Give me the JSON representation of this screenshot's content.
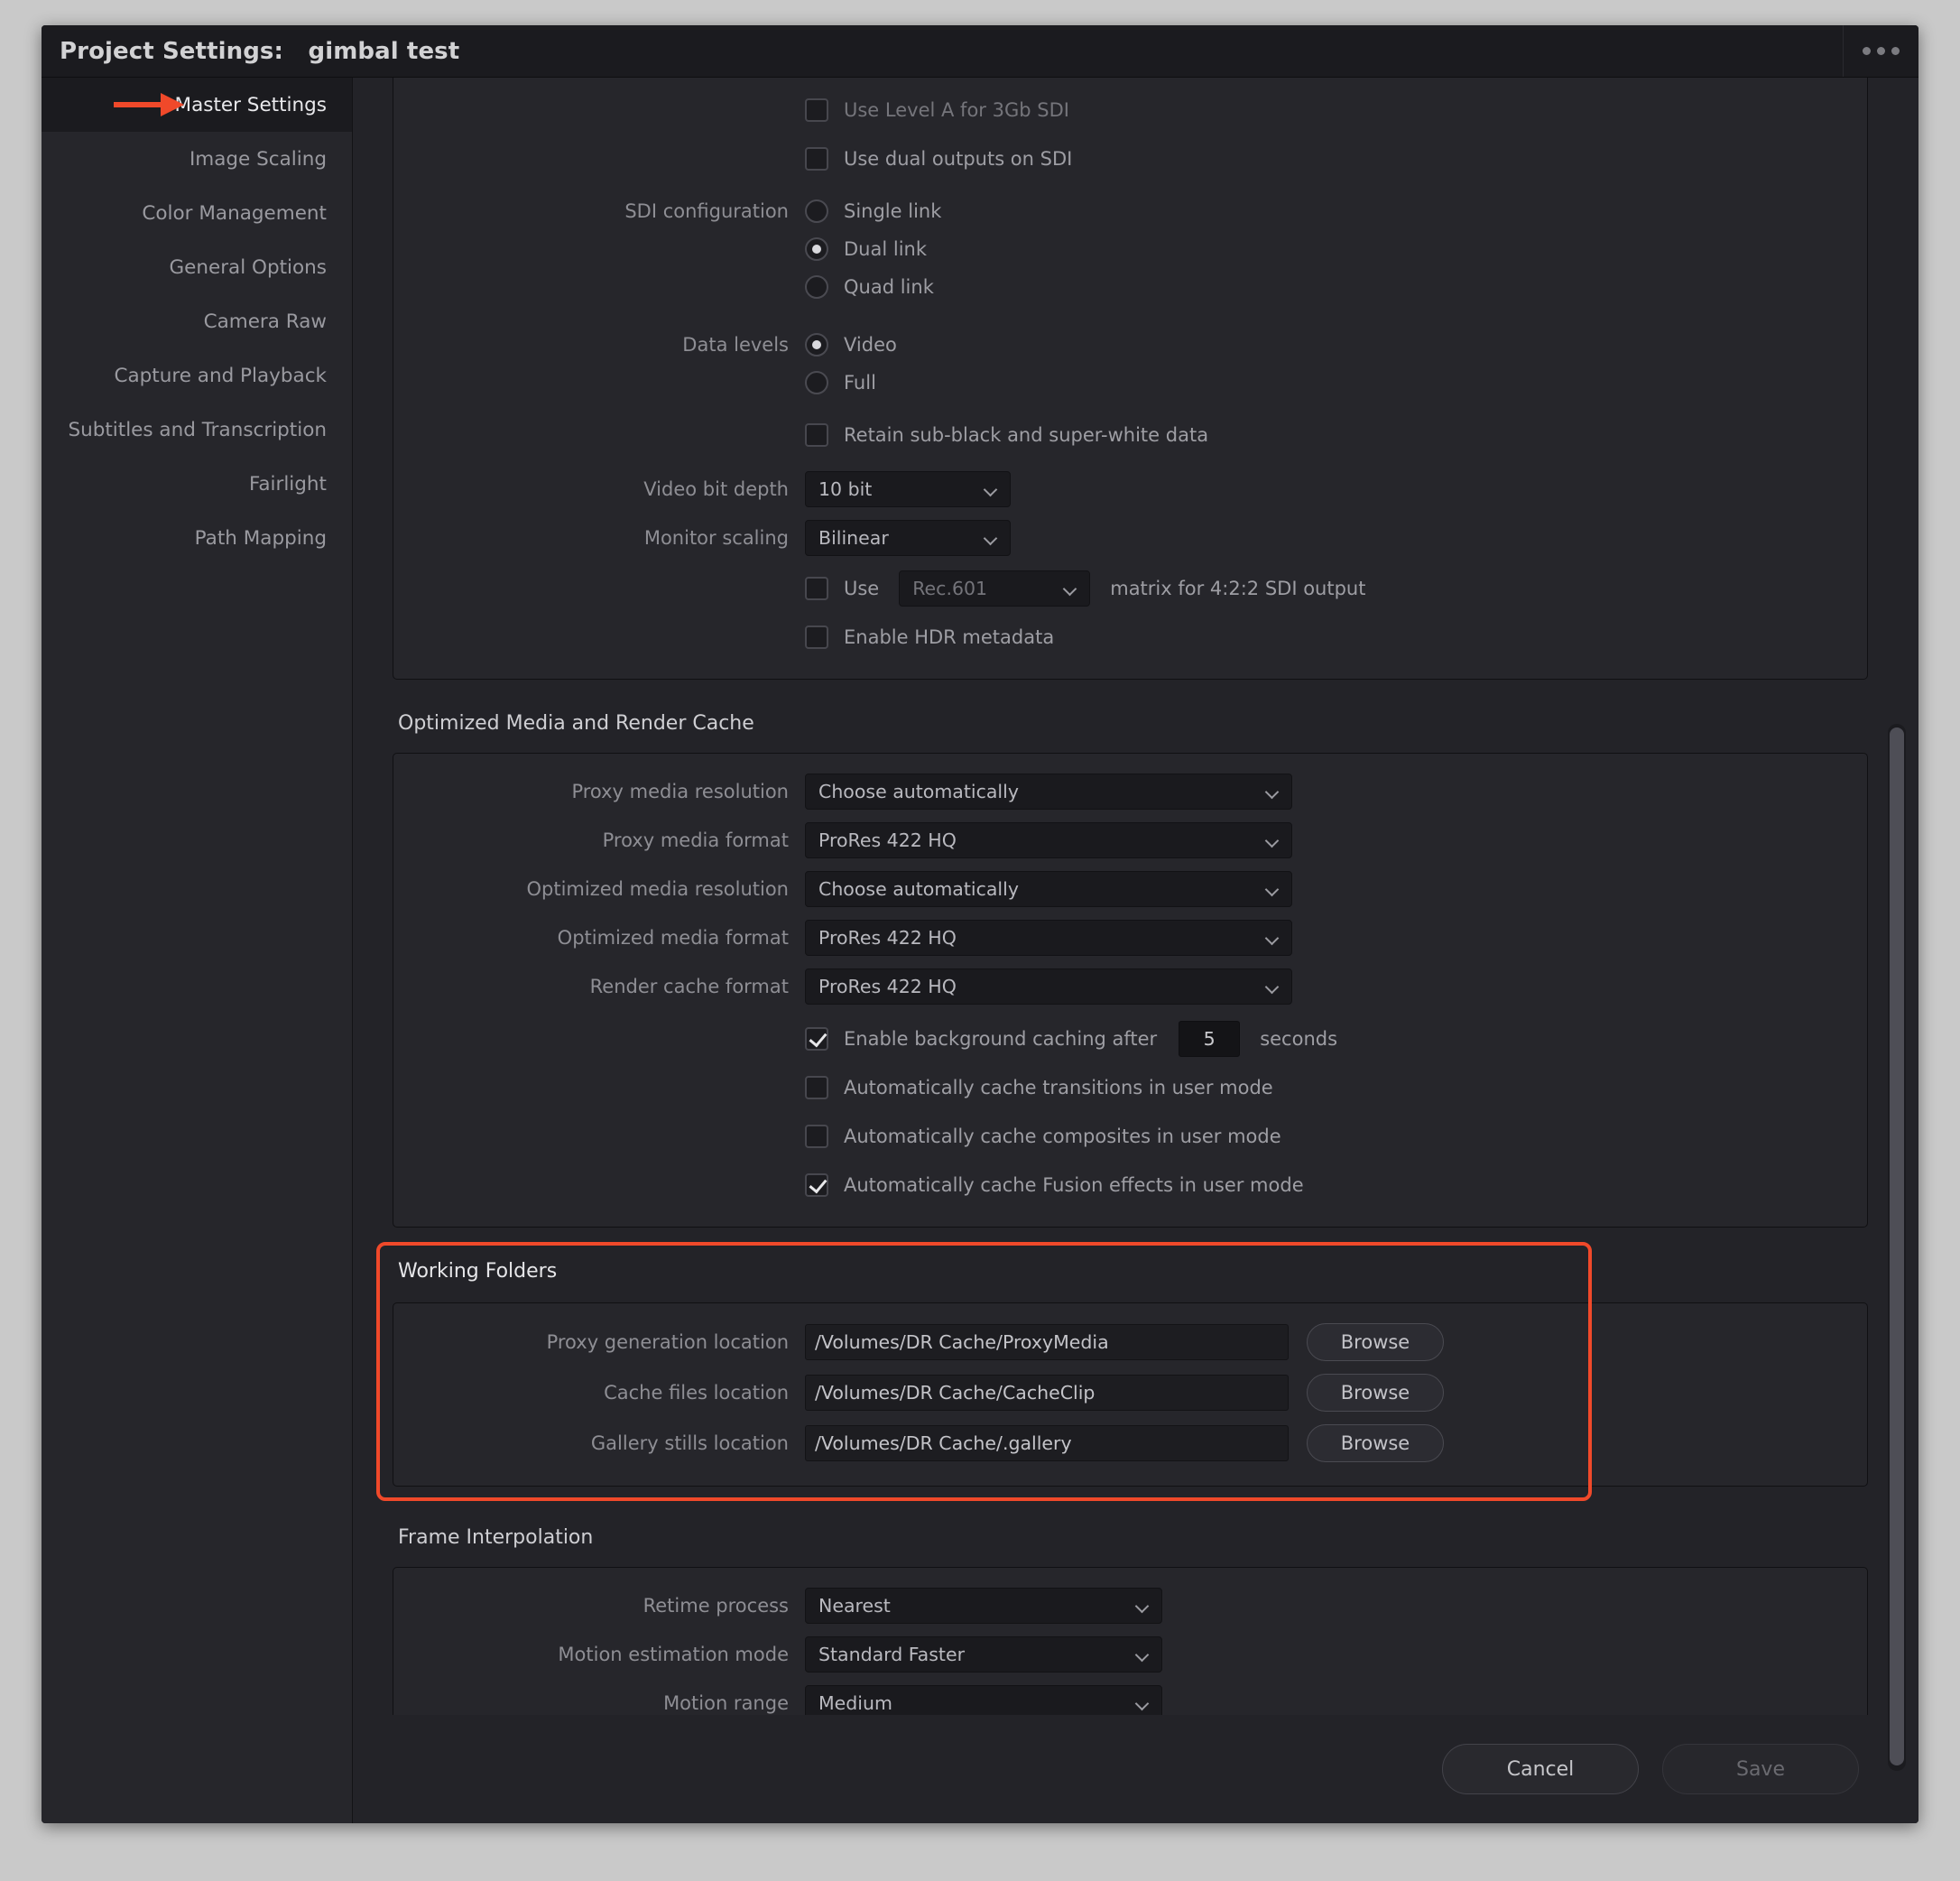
{
  "window": {
    "title_prefix": "Project Settings:",
    "project_name": "gimbal test",
    "menu_icon": "more-horizontal-icon"
  },
  "sidebar": {
    "items": [
      {
        "label": "Master Settings",
        "active": true
      },
      {
        "label": "Image Scaling",
        "active": false
      },
      {
        "label": "Color Management",
        "active": false
      },
      {
        "label": "General Options",
        "active": false
      },
      {
        "label": "Camera Raw",
        "active": false
      },
      {
        "label": "Capture and Playback",
        "active": false
      },
      {
        "label": "Subtitles and Transcription",
        "active": false
      },
      {
        "label": "Fairlight",
        "active": false
      },
      {
        "label": "Path Mapping",
        "active": false
      }
    ],
    "pointer_color": "#f0492a"
  },
  "video_monitoring": {
    "use_level_a": {
      "label": "Use Level A for 3Gb SDI",
      "checked": false
    },
    "use_dual_outputs": {
      "label": "Use dual outputs on SDI",
      "checked": false
    },
    "sdi_configuration": {
      "label": "SDI configuration",
      "options": [
        "Single link",
        "Dual link",
        "Quad link"
      ],
      "selected": "Dual link"
    },
    "data_levels": {
      "label": "Data levels",
      "options": [
        "Video",
        "Full"
      ],
      "selected": "Video"
    },
    "retain_sub_black": {
      "label": "Retain sub-black and super-white data",
      "checked": false
    },
    "video_bit_depth": {
      "label": "Video bit depth",
      "value": "10 bit"
    },
    "monitor_scaling": {
      "label": "Monitor scaling",
      "value": "Bilinear"
    },
    "matrix": {
      "use_label": "Use",
      "checked": false,
      "value": "Rec.601",
      "suffix": "matrix for 4:2:2 SDI output"
    },
    "enable_hdr_metadata": {
      "label": "Enable HDR metadata",
      "checked": false
    }
  },
  "optimized_media": {
    "section_title": "Optimized Media and Render Cache",
    "proxy_media_resolution": {
      "label": "Proxy media resolution",
      "value": "Choose automatically"
    },
    "proxy_media_format": {
      "label": "Proxy media format",
      "value": "ProRes 422 HQ"
    },
    "optimized_media_resolution": {
      "label": "Optimized media resolution",
      "value": "Choose automatically"
    },
    "optimized_media_format": {
      "label": "Optimized media format",
      "value": "ProRes 422 HQ"
    },
    "render_cache_format": {
      "label": "Render cache format",
      "value": "ProRes 422 HQ"
    },
    "background_caching": {
      "label": "Enable background caching after",
      "checked": true,
      "seconds_value": "5",
      "seconds_suffix": "seconds"
    },
    "cache_transitions": {
      "label": "Automatically cache transitions in user mode",
      "checked": false
    },
    "cache_composites": {
      "label": "Automatically cache composites in user mode",
      "checked": false
    },
    "cache_fusion": {
      "label": "Automatically cache Fusion effects in user mode",
      "checked": true
    }
  },
  "working_folders": {
    "section_title": "Working Folders",
    "highlight_color": "#f0492a",
    "browse_label": "Browse",
    "rows": [
      {
        "label": "Proxy generation location",
        "value": "/Volumes/DR Cache/ProxyMedia"
      },
      {
        "label": "Cache files location",
        "value": "/Volumes/DR Cache/CacheClip"
      },
      {
        "label": "Gallery stills location",
        "value": "/Volumes/DR Cache/.gallery"
      }
    ]
  },
  "frame_interpolation": {
    "section_title": "Frame Interpolation",
    "retime_process": {
      "label": "Retime process",
      "value": "Nearest"
    },
    "motion_estimation_mode": {
      "label": "Motion estimation mode",
      "value": "Standard Faster"
    },
    "motion_range": {
      "label": "Motion range",
      "value": "Medium"
    }
  },
  "footer": {
    "cancel_label": "Cancel",
    "save_label": "Save"
  }
}
